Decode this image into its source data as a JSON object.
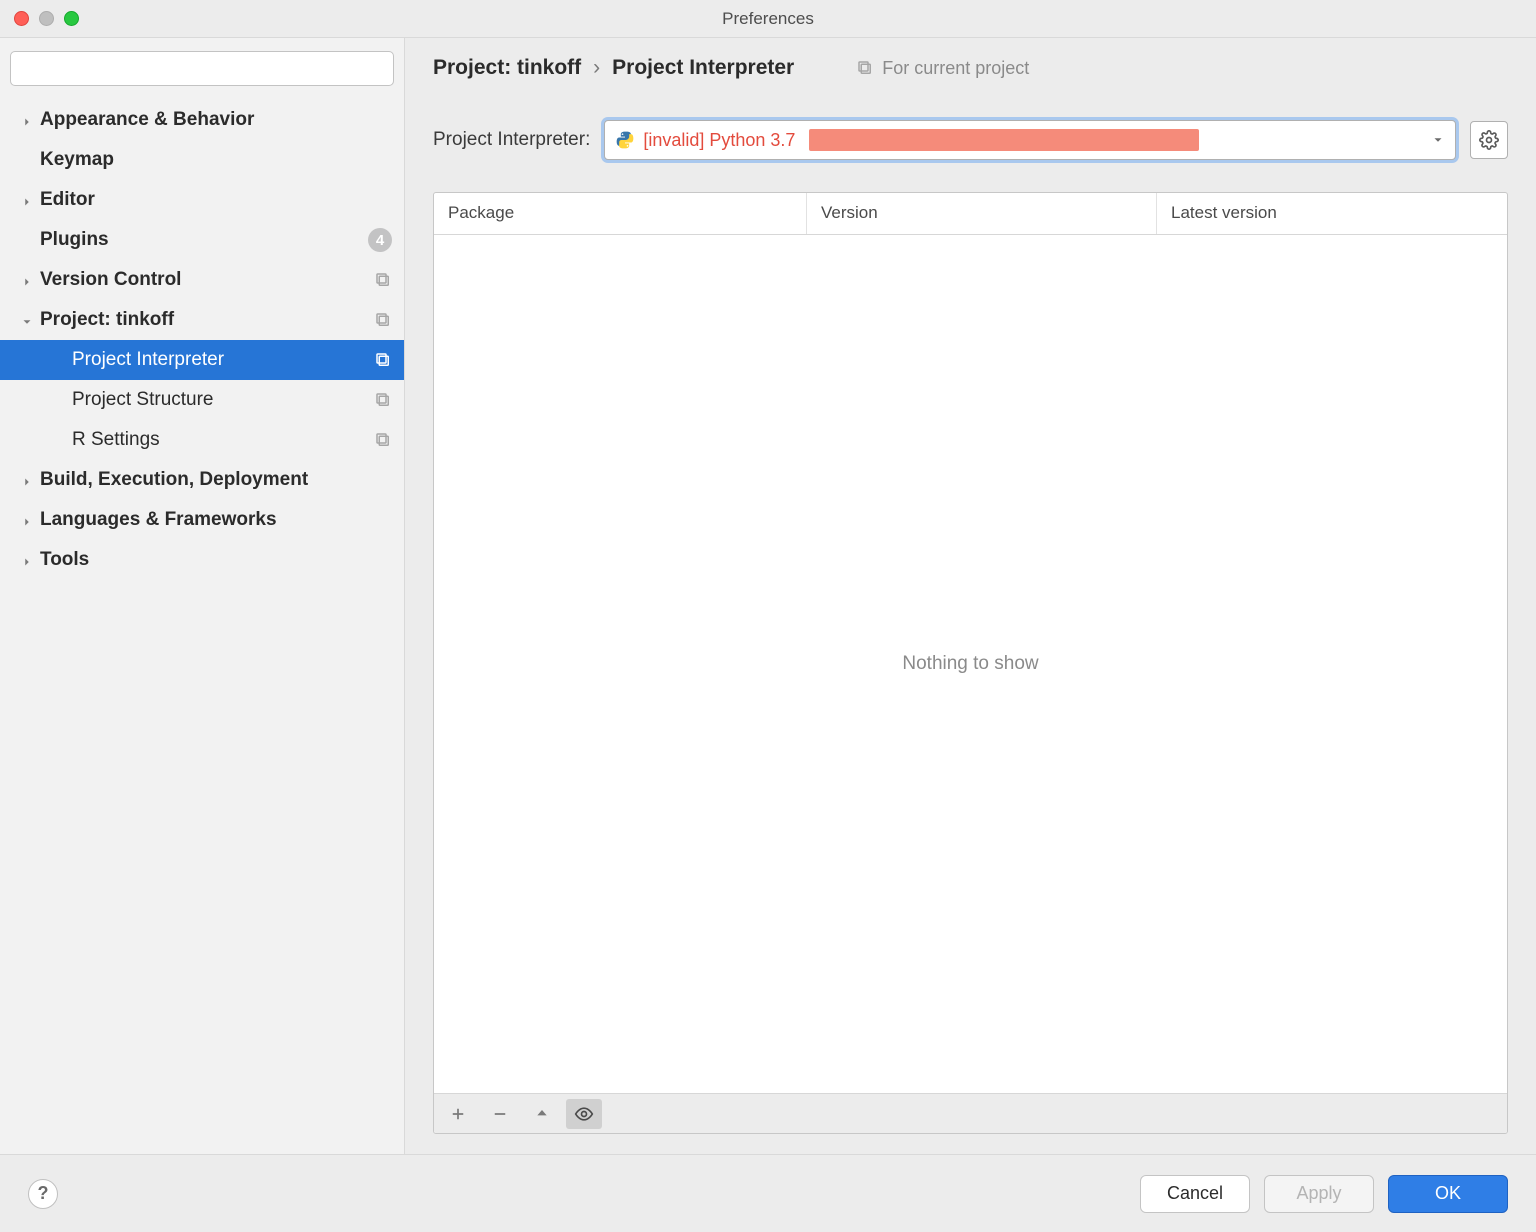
{
  "window": {
    "title": "Preferences"
  },
  "sidebar": {
    "search_placeholder": "",
    "items": [
      {
        "label": "Appearance & Behavior",
        "bold": true,
        "arrow": "right"
      },
      {
        "label": "Keymap",
        "bold": true,
        "arrow": "none"
      },
      {
        "label": "Editor",
        "bold": true,
        "arrow": "right"
      },
      {
        "label": "Plugins",
        "bold": true,
        "arrow": "none",
        "badge": "4"
      },
      {
        "label": "Version Control",
        "bold": true,
        "arrow": "right",
        "trailing": "copy"
      },
      {
        "label": "Project: tinkoff",
        "bold": true,
        "arrow": "down",
        "trailing": "copy"
      },
      {
        "label": "Project Interpreter",
        "child": true,
        "selected": true,
        "trailing": "copy"
      },
      {
        "label": "Project Structure",
        "child": true,
        "trailing": "copy"
      },
      {
        "label": "R Settings",
        "child": true,
        "trailing": "copy"
      },
      {
        "label": "Build, Execution, Deployment",
        "bold": true,
        "arrow": "right"
      },
      {
        "label": "Languages & Frameworks",
        "bold": true,
        "arrow": "right"
      },
      {
        "label": "Tools",
        "bold": true,
        "arrow": "right"
      }
    ]
  },
  "breadcrumb": {
    "part1": "Project: tinkoff",
    "sep": "›",
    "part2": "Project Interpreter",
    "for_project": "For current project"
  },
  "interpreter": {
    "label": "Project Interpreter:",
    "value": "[invalid] Python 3.7"
  },
  "table": {
    "columns": [
      "Package",
      "Version",
      "Latest version"
    ],
    "empty_text": "Nothing to show"
  },
  "footer": {
    "help": "?",
    "cancel": "Cancel",
    "apply": "Apply",
    "ok": "OK"
  }
}
